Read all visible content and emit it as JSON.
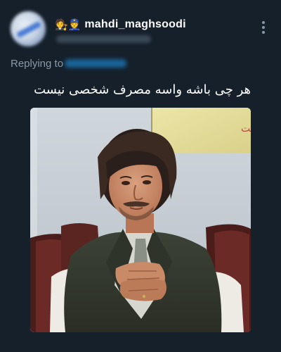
{
  "tweet": {
    "author": {
      "emoji_prefix": "🧑‍⚖️👮",
      "display_name": "mahdi_maghsoodi"
    },
    "replying_prefix": "Replying to",
    "text": "هر چی باشه واسه مصرف شخصی نیست ...",
    "media": {
      "sign_text": "متم دیده است"
    }
  },
  "colors": {
    "background": "#15202b",
    "secondary_text": "#8b98a5",
    "link": "#1d9bf0",
    "primary_text": "#ffffff"
  },
  "icons": {
    "more": "more-vertical-icon"
  }
}
